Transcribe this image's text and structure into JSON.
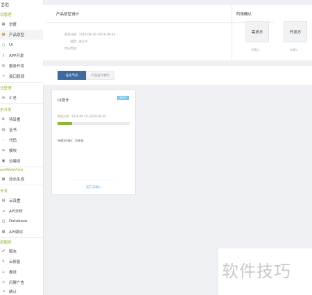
{
  "sidebar": {
    "title": "艺范",
    "sections": [
      {
        "label": "目管理",
        "items": [
          {
            "label": "进度",
            "icon": "calendar-icon"
          },
          {
            "label": "产品原型",
            "icon": "folder-icon"
          },
          {
            "label": "UI",
            "icon": "ui-icon"
          },
          {
            "label": "APP开发",
            "icon": "phone-icon"
          },
          {
            "label": "服务开发",
            "icon": "server-icon"
          },
          {
            "label": "接口联调",
            "icon": "link-icon"
          }
        ]
      },
      {
        "label": "试管理",
        "items": [
          {
            "label": "汇总",
            "icon": "list-icon"
          }
        ]
      },
      {
        "label": "护开发",
        "items": [
          {
            "label": "待设置",
            "icon": "settings-icon"
          },
          {
            "label": "证书",
            "icon": "certificate-icon"
          },
          {
            "label": "代码",
            "icon": "code-icon"
          },
          {
            "label": "模块",
            "icon": "module-icon"
          },
          {
            "label": "云编译",
            "icon": "cloud-build-icon"
          }
        ]
      },
      {
        "label": "apiWebView",
        "items": [
          {
            "label": "动态生成",
            "icon": "generate-icon"
          }
        ]
      },
      {
        "label": "开发",
        "items": [
          {
            "label": "云设置",
            "icon": "cloud-settings-icon"
          },
          {
            "label": "API分析",
            "icon": "chart-icon"
          },
          {
            "label": "Database",
            "icon": "database-icon"
          },
          {
            "label": "API调试",
            "icon": "debug-icon"
          }
        ]
      },
      {
        "label": "用服务",
        "items": [
          {
            "label": "版本",
            "icon": "version-icon"
          },
          {
            "label": "云修复",
            "icon": "repair-icon"
          },
          {
            "label": "推送",
            "icon": "push-icon"
          },
          {
            "label": "闪屏广告",
            "icon": "ad-icon"
          },
          {
            "label": "统计",
            "icon": "stats-icon"
          }
        ]
      }
    ]
  },
  "header": {
    "title": "产品原型设计",
    "meta": [
      "原型计划：2016-09-20~2016-09-30",
      "进度：进行中",
      "实际完成："
    ],
    "stage": {
      "title": "阶段确认",
      "boxes": [
        {
          "label": "需求方",
          "status": "未确认"
        },
        {
          "label": "开发方",
          "status": "未确认"
        }
      ]
    }
  },
  "tabs": [
    {
      "label": "任务节点"
    },
    {
      "label": "产品设计材料"
    }
  ],
  "task_card": {
    "title": "UI设计",
    "badge": "进行中",
    "date": "原型计划：2016-09-16~2016-09-30",
    "progress": 0.2,
    "deliverable": "待提交材料：0/多份",
    "link": "双方未确认"
  },
  "watermark": "软件技巧"
}
